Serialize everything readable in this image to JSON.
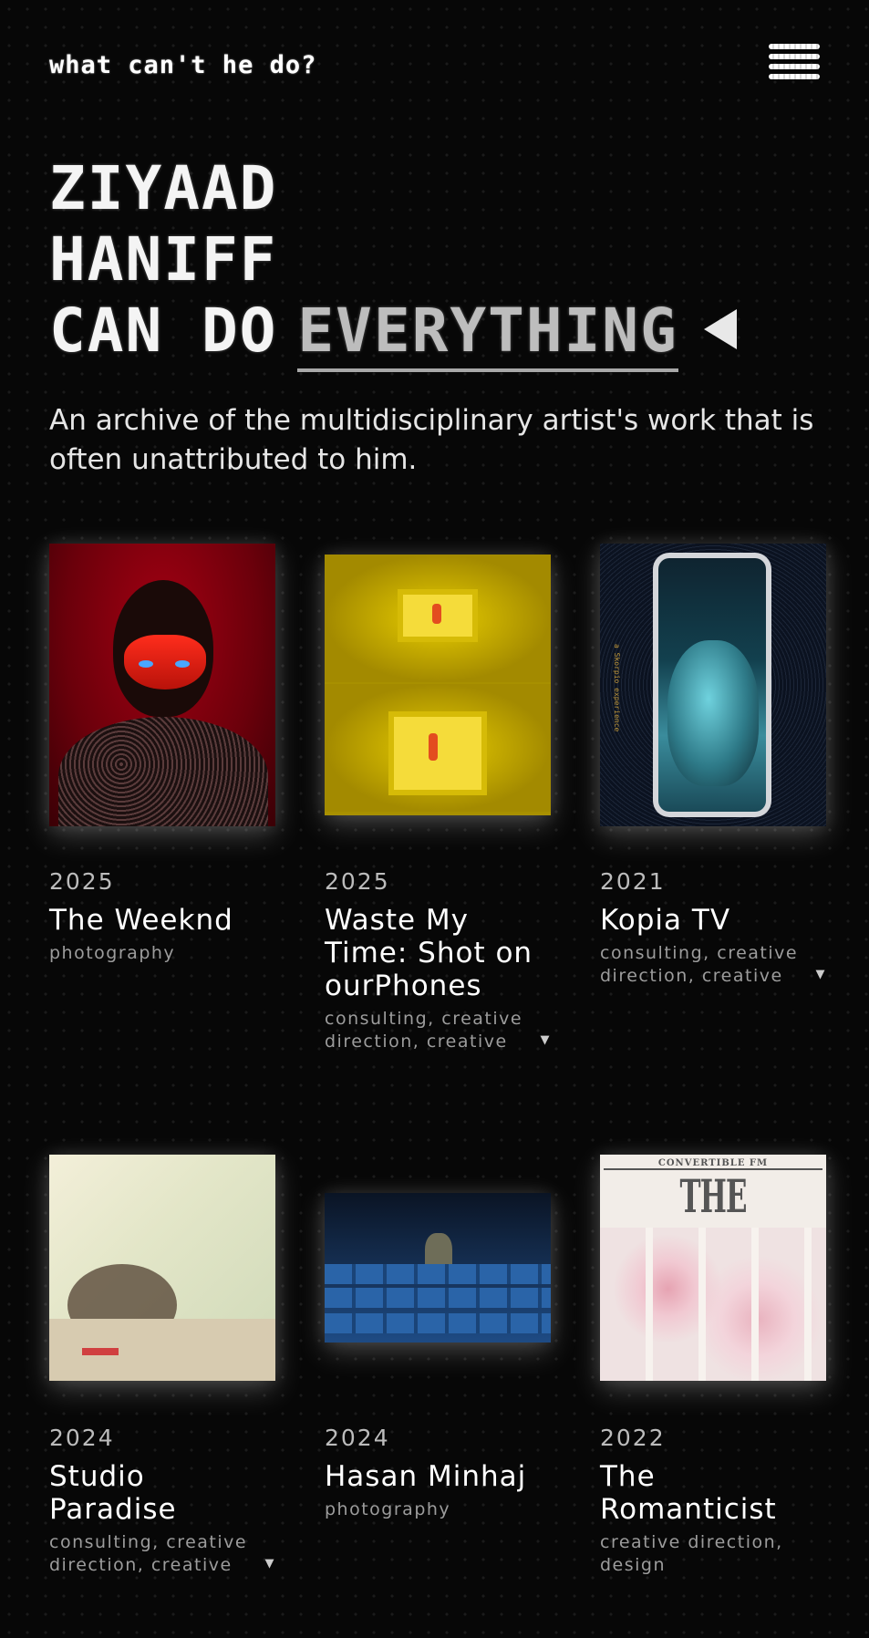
{
  "header": {
    "site_title": "what can't he do?",
    "menu_icon": "hamburger-menu-icon"
  },
  "hero": {
    "line1": "ZIYAAD",
    "line2": "HANIFF",
    "line3_prefix": "CAN DO",
    "line3_word": "EVERYTHING",
    "cursor_icon": "arrow-left-icon",
    "description": "An archive of the multidisciplinary artist's work that is often unattributed to him."
  },
  "projects": [
    {
      "year": "2025",
      "title": "The Weeknd",
      "tags": "photography",
      "expandable": false
    },
    {
      "year": "2025",
      "title": "Waste My Time: Shot on ourPhones",
      "tags": "consulting, creative direction, creative",
      "expandable": true
    },
    {
      "year": "2021",
      "title": "Kopia TV",
      "tags": "consulting, creative direction, creative",
      "expandable": true,
      "thumb_text": "a Skorpio experience"
    },
    {
      "year": "2024",
      "title": "Studio Paradise",
      "tags": "consulting, creative direction, creative",
      "expandable": true
    },
    {
      "year": "2024",
      "title": "Hasan Minhaj",
      "tags": "photography",
      "expandable": false
    },
    {
      "year": "2022",
      "title": "The Romanticist",
      "tags": "creative direction, design",
      "expandable": false,
      "thumb_header": "CONVERTIBLE FM",
      "thumb_masthead": "THE ROMANTICIST"
    }
  ],
  "caret_glyph": "▼"
}
